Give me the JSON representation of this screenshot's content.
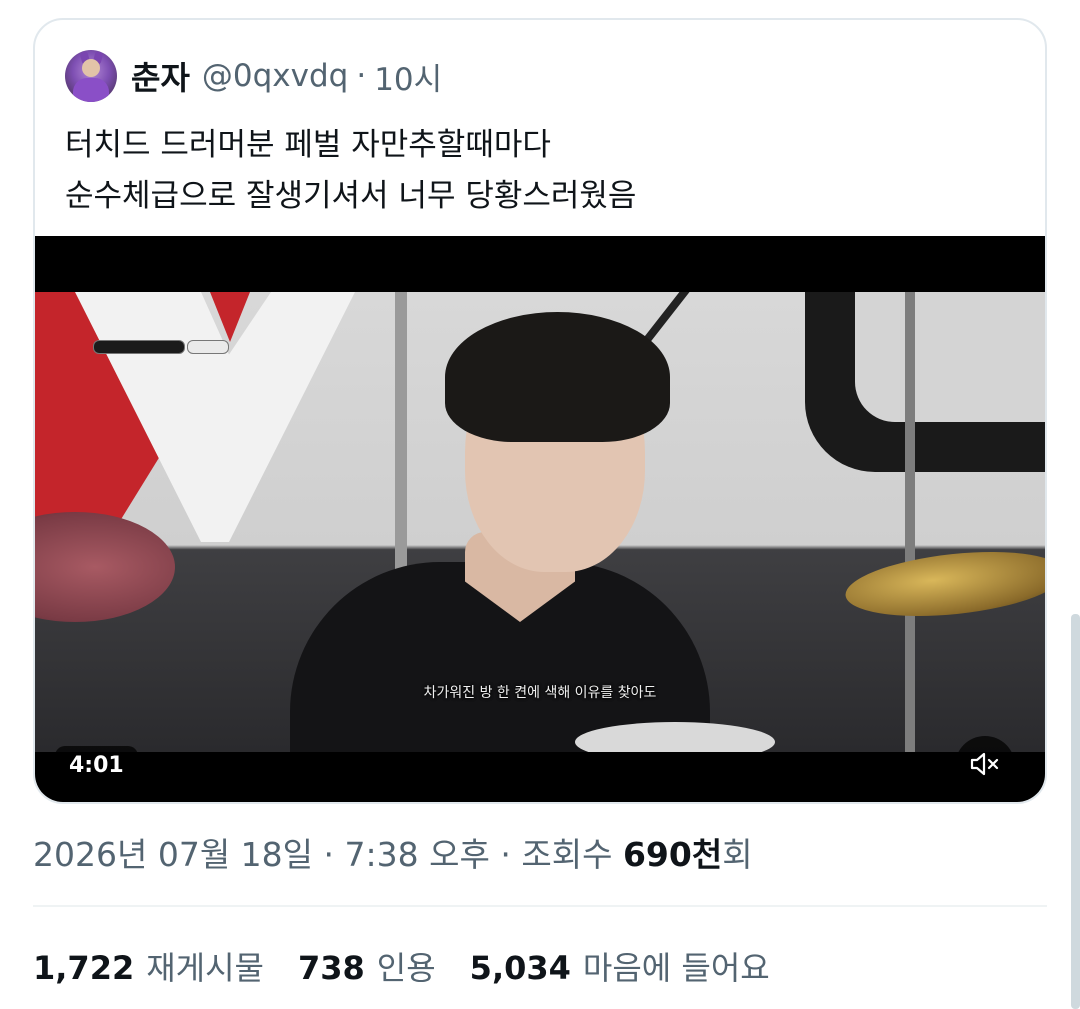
{
  "quoted_tweet": {
    "author_name": "춘자",
    "handle": "@0qxvdq",
    "separator": "·",
    "time": "10시",
    "text": "터치드 드러머분 페벌 자만추할때마다\n순수체급으로 잘생기셔서 너무 당황스러웠음",
    "video": {
      "duration": "4:01",
      "subtitle": "차가워진 방 한 켠에 색해 이유를 찾아도",
      "mute_icon": "volume-muted-icon"
    }
  },
  "meta": {
    "date": "2026년 07월 18일",
    "sep1": "·",
    "time": "7:38 오후",
    "sep2": "·",
    "views_prefix": "조회수",
    "views_count": "690천",
    "views_suffix": "회"
  },
  "stats": {
    "retweets_count": "1,722",
    "retweets_label": "재게시물",
    "quotes_count": "738",
    "quotes_label": "인용",
    "likes_count": "5,034",
    "likes_label": "마음에 들어요"
  }
}
